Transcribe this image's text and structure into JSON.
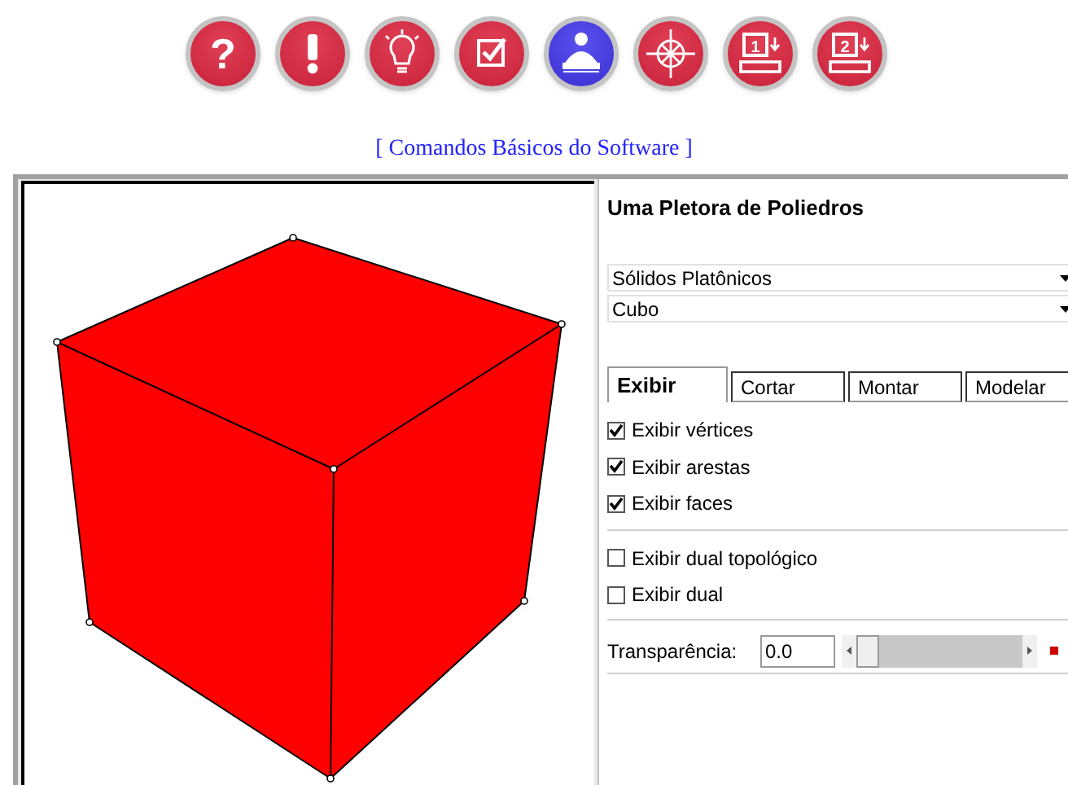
{
  "toolbar": [
    {
      "kind": "question",
      "glyph": "?",
      "selected": false
    },
    {
      "kind": "exclamation",
      "selected": false
    },
    {
      "kind": "bulb",
      "selected": false
    },
    {
      "kind": "checkbox",
      "selected": false
    },
    {
      "kind": "reader",
      "selected": true
    },
    {
      "kind": "compass",
      "selected": false
    },
    {
      "kind": "computer",
      "glyph": "1",
      "selected": false
    },
    {
      "kind": "computer",
      "glyph": "2",
      "selected": false
    }
  ],
  "link": "[ Comandos Básicos do Software ]",
  "panel": {
    "title": "Uma Pletora de Poliedros",
    "dropdowns": [
      "Sólidos Platônicos",
      "Cubo"
    ],
    "tabs": [
      {
        "label": "Exibir",
        "selected": true
      },
      {
        "label": "Cortar",
        "selected": false
      },
      {
        "label": "Montar",
        "selected": false
      },
      {
        "label": "Modelar",
        "selected": false
      }
    ],
    "option_groups": [
      [
        {
          "label": "Exibir vértices",
          "checked": true
        },
        {
          "label": "Exibir arestas",
          "checked": true
        },
        {
          "label": "Exibir faces",
          "checked": true
        }
      ],
      [
        {
          "label": "Exibir dual topológico",
          "checked": false
        },
        {
          "label": "Exibir dual",
          "checked": false
        }
      ]
    ],
    "transparency": {
      "label": "Transparência:",
      "value": "0.0",
      "level": 0,
      "color": "#cc0000"
    }
  }
}
